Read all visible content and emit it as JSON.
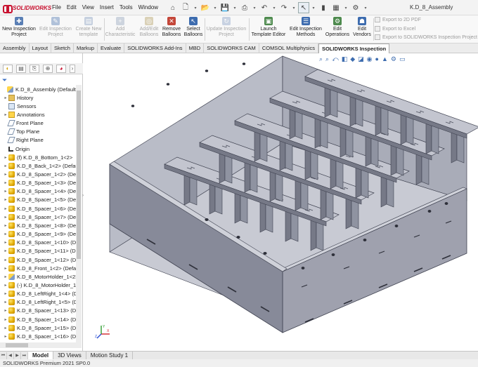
{
  "app": {
    "logo": "SOLIDWORKS",
    "window_title": "K.D_8_Assembly"
  },
  "menu": [
    "File",
    "Edit",
    "View",
    "Insert",
    "Tools",
    "Window"
  ],
  "ribbon": {
    "buttons": [
      {
        "label": "New Inspection Project",
        "enabled": true
      },
      {
        "label": "Edit Inspection Project",
        "enabled": false
      },
      {
        "label": "Create New template",
        "enabled": false
      },
      {
        "label": "Add Characteristic",
        "enabled": false
      },
      {
        "label": "Add/Edit Balloons",
        "enabled": false
      },
      {
        "label": "Remove Balloons",
        "enabled": true
      },
      {
        "label": "Select Balloons",
        "enabled": true
      },
      {
        "label": "Update Inspection Project",
        "enabled": false
      },
      {
        "label": "Launch Template Editor",
        "enabled": true
      },
      {
        "label": "Edit Inspection Methods",
        "enabled": true
      },
      {
        "label": "Edit Operations",
        "enabled": true
      },
      {
        "label": "Edit Vendors",
        "enabled": true
      }
    ],
    "export": [
      "Export to 2D PDF",
      "Export to Excel",
      "Export to SOLIDWORKS Inspection Project"
    ]
  },
  "command_tabs": [
    "Assembly",
    "Layout",
    "Sketch",
    "Markup",
    "Evaluate",
    "SOLIDWORKS Add-Ins",
    "MBD",
    "SOLIDWORKS CAM",
    "COMSOL Multiphysics",
    "SOLIDWORKS Inspection"
  ],
  "active_command_tab": "SOLIDWORKS Inspection",
  "tree": {
    "root": "K.D_8_Assembly  (Default<Default_Display State-1>)",
    "items": [
      "History",
      "Sensors",
      "Annotations",
      "Front Plane",
      "Top Plane",
      "Right Plane",
      "Origin",
      "(f) K.D_8_Bottom_1<2>",
      "K.D_8_Back_1<2> (Default)",
      "K.D_8_Spacer_1<2> (Default)",
      "K.D_8_Spacer_1<3> (Default)",
      "K.D_8_Spacer_1<4> (Default)",
      "K.D_8_Spacer_1<5> (Default)",
      "K.D_8_Spacer_1<6> (Default)",
      "K.D_8_Spacer_1<7> (Default)",
      "K.D_8_Spacer_1<8> (Default)",
      "K.D_8_Spacer_1<9> (Default)",
      "K.D_8_Spacer_1<10> (Default)",
      "K.D_8_Spacer_1<11> (Default)",
      "K.D_8_Spacer_1<12> (Default)",
      "K.D_8_Front_1<2> (Default)",
      "K.D_8_MotorHolder_1<2>",
      "(-) K.D_8_MotorHolder_1<3>",
      "K.D_8_LeftRight_1<4> (Default)",
      "K.D_8_LeftRight_1<5> (Default)",
      "K.D_8_Spacer_1<13> (Default)",
      "K.D_8_Spacer_1<14> (Default)",
      "K.D_8_Spacer_1<15> (Default)",
      "K.D_8_Spacer_1<16> (Default)"
    ]
  },
  "bottom_tabs": [
    "Model",
    "3D Views",
    "Motion Study 1"
  ],
  "active_bottom_tab": "Model",
  "status": "SOLIDWORKS Premium 2021 SP0.0",
  "colors": {
    "brand": "#c8102e",
    "model_face": "#9fa1ae",
    "model_dark": "#767987",
    "model_top": "#c3c5cf",
    "accent": "#3d6caf"
  },
  "icons": {
    "triad": "xyz-triad-icon",
    "hud": [
      "zoom-fit-icon",
      "zoom-area-icon",
      "previous-view-icon",
      "section-view-icon",
      "view-orientation-icon",
      "display-style-icon",
      "hide-show-icon",
      "appearance-icon",
      "scene-icon",
      "view-settings-icon",
      "monitor-icon"
    ]
  },
  "triad": {
    "x": "X",
    "y": "Y",
    "z": "Z"
  }
}
